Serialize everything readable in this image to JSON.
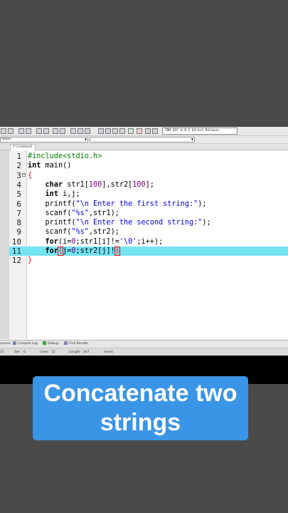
{
  "toolbar": {
    "compiler_select": "TDM-GCC 4.9.2 64-bit Release"
  },
  "scope": {
    "left": "obals)",
    "middle": ""
  },
  "tabs": [
    {
      "label": "[*] Untitled1"
    }
  ],
  "editor": {
    "line_numbers": [
      "1",
      "2",
      "3",
      "4",
      "5",
      "6",
      "7",
      "8",
      "9",
      "10",
      "11",
      "12"
    ],
    "lines": {
      "l1_pp": "#include<stdio.h>",
      "l2_kw": "int",
      "l2_rest": " main()",
      "l3": "{",
      "l4_kw": "char",
      "l4_a": " str1[",
      "l4_n1": "100",
      "l4_b": "],str2[",
      "l4_n2": "100",
      "l4_c": "];",
      "l5_kw": "int",
      "l5_rest": " i,j;",
      "l6_a": "printf(",
      "l6_str": "\"\\n Enter the first string:\"",
      "l6_b": ");",
      "l7_a": "scanf(",
      "l7_str": "\"%s\"",
      "l7_b": ",str1);",
      "l8_a": "printf(",
      "l8_str": "\"\\n Enter the second string:\"",
      "l8_b": ");",
      "l9_a": "scanf(",
      "l9_str": "\"%s\"",
      "l9_b": ",str2);",
      "l10_kw": "for",
      "l10_a": "(i=",
      "l10_n": "0",
      "l10_b": ";str1[i]!=",
      "l10_c": "'\\0'",
      "l10_d": ";i++);",
      "l11_kw": "for",
      "l11_open": "(",
      "l11_a": "j=",
      "l11_n": "0",
      "l11_b": ";str2[j]!",
      "l11_close": ")",
      "l12": "}"
    }
  },
  "bottom_tabs": [
    {
      "label": "ources"
    },
    {
      "label": "Compile Log"
    },
    {
      "label": "Debug"
    },
    {
      "label": "Find Results"
    }
  ],
  "status": {
    "line": "11",
    "col_label": "Sel:",
    "col": "0",
    "lines_label": "Lines:",
    "lines": "12",
    "length_label": "Length:",
    "length": "247",
    "mode": "Insert"
  },
  "caption": {
    "line1": "Concatenate two",
    "line2": "strings"
  },
  "colors": {
    "highlight_line": "#73e3f2",
    "caption_bg": "#3a95e6",
    "page_bg": "#4a4a4a"
  }
}
